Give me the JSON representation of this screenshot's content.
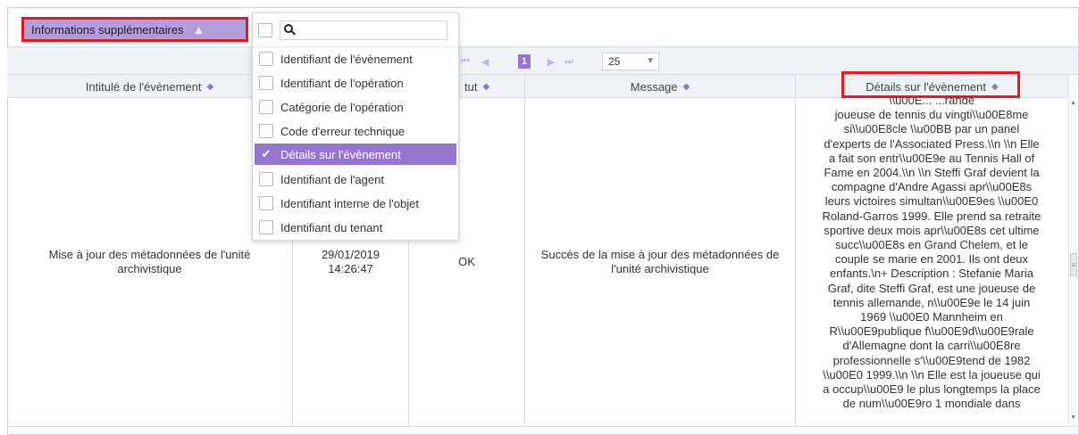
{
  "toolbar": {
    "toggle_label": "Informations supplémentaires",
    "toggle_icon": "chevron-up-icon"
  },
  "pager": {
    "current_page": "1",
    "rows_per_page": "25"
  },
  "columns_menu": {
    "search_placeholder": "",
    "items": [
      {
        "label": "Identifiant de l'évènement",
        "checked": false
      },
      {
        "label": "Identifiant de l'opération",
        "checked": false
      },
      {
        "label": "Catégorie de l'opération",
        "checked": false
      },
      {
        "label": "Code d'erreur technique",
        "checked": false
      },
      {
        "label": "Détails sur l'évènement",
        "checked": true
      },
      {
        "label": "Identifiant de l'agent",
        "checked": false
      },
      {
        "label": "Identifiant interne de l'objet",
        "checked": false
      },
      {
        "label": "Identifiant du tenant",
        "checked": false
      }
    ]
  },
  "table": {
    "headers": {
      "intitule": "Intitulé de l'évènement",
      "date": "",
      "statut": "tut",
      "message": "Message",
      "details": "Détails sur l'évènement"
    },
    "row": {
      "intitule": "Mise à jour des métadonnées de l'unité archivistique",
      "date": "29/01/2019\n14:26:47",
      "statut": "OK",
      "message": "Succès de la mise à jour des métadonnées de l'unité archivistique",
      "details": "\\\\u00E... ...rande\njoueuse de tennis du vingti\\\\u00E8me\nsi\\\\u00E8cle \\\\u00BB par un panel\nd'experts de l'Associated Press.\\\\n \\\\n Elle\na fait son entr\\\\u00E9e au Tennis Hall of\nFame en 2004.\\\\n \\\\n Steffi Graf devient la\ncompagne d'Andre Agassi apr\\\\u00E8s\nleurs victoires simultan\\\\u00E9es \\\\u00E0\nRoland-Garros 1999. Elle prend sa retraite\nsportive deux mois apr\\\\u00E8s cet ultime\nsucc\\\\u00E8s en Grand Chelem, et le\ncouple se marie en 2001. Ils ont deux\nenfants.\\n+ Description : Stefanie Maria\nGraf, dite Steffi Graf, est une joueuse de\ntennis allemande, n\\\\u00E9e le 14 juin\n1969 \\\\u00E0 Mannheim en\nR\\\\u00E9publique f\\\\u00E9d\\\\u00E9rale\nd'Allemagne dont la carri\\\\u00E8re\nprofessionnelle s'\\\\u00E9tend de 1982\n\\\\u00E0 1999.\\\\n \\\\n Elle est la joueuse qui\na occup\\\\u00E9 le plus longtemps la place\nde num\\\\u00E9ro 1 mondiale dans"
    }
  },
  "colors": {
    "accent": "#9575cd",
    "highlight_border": "#e8191a",
    "header_bg": "#eef1f5"
  }
}
